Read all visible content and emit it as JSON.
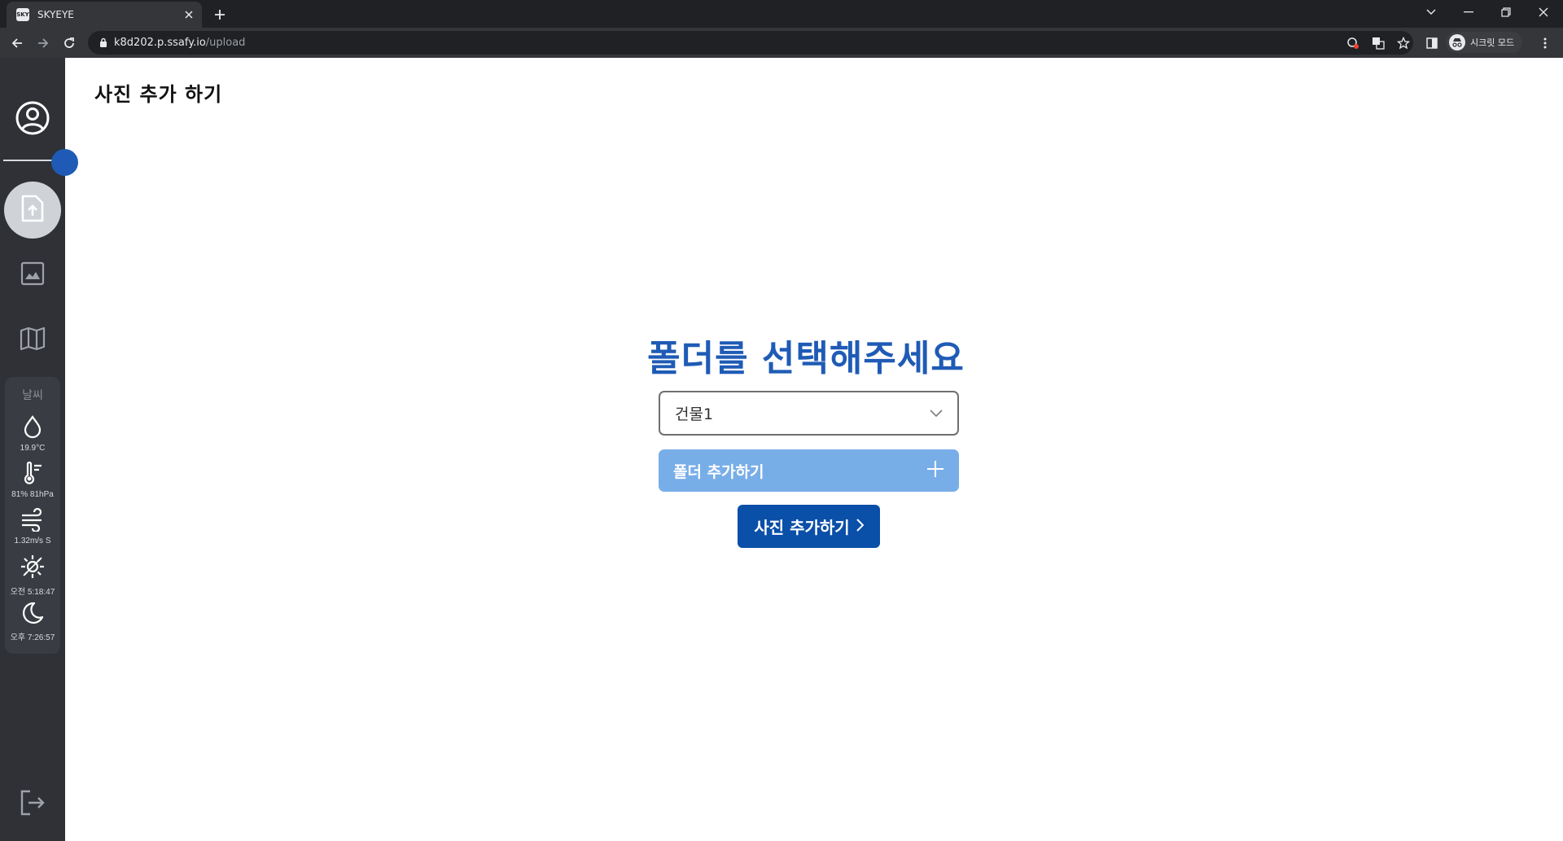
{
  "browser": {
    "tab_title": "SKYEYE",
    "favicon_text": "SKY\nEYE",
    "url_host": "k8d202.p.ssafy.io",
    "url_path": "/upload",
    "incognito_label": "시크릿 모드"
  },
  "sidebar": {
    "items": [
      {
        "icon": "user-circle-icon"
      },
      {
        "icon": "upload-file-icon",
        "active": true
      },
      {
        "icon": "image-icon"
      },
      {
        "icon": "map-icon"
      }
    ],
    "weather": {
      "title": "날씨",
      "humidity_drop_value": "19.9°C",
      "thermometer_value": "81% 81hPa",
      "wind_value": "1.32m/s S",
      "sunrise_value": "오전 5:18:47",
      "sunset_value": "오후 7:26:57"
    }
  },
  "main": {
    "page_heading": "사진 추가 하기",
    "title": "폴더를 선택해주세요",
    "folder_select_value": "건물1",
    "add_folder_label": "폴더 추가하기",
    "add_photo_label": "사진 추가하기"
  },
  "colors": {
    "accent": "#1f5bb6",
    "button_dark": "#0a4fa8",
    "button_light": "#78aee8",
    "sidebar_bg": "#2f3136"
  }
}
